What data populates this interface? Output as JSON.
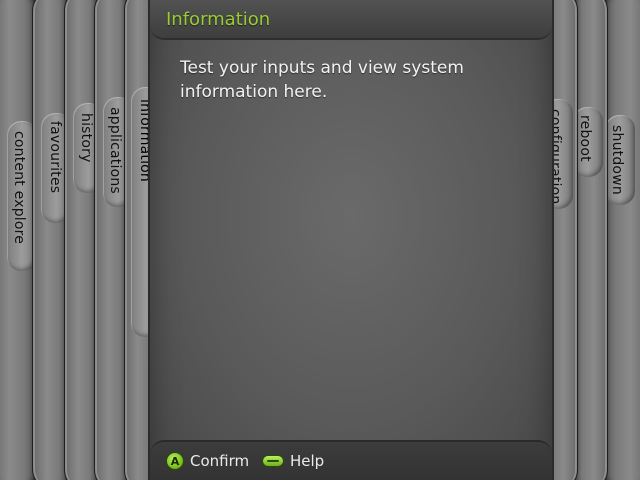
{
  "left_blades": [
    {
      "label": "content explore"
    },
    {
      "label": "favourites"
    },
    {
      "label": "history"
    },
    {
      "label": "applications"
    },
    {
      "label": "information"
    }
  ],
  "right_blades": [
    {
      "label": "configuration"
    },
    {
      "label": "reboot"
    },
    {
      "label": "shutdown"
    }
  ],
  "header": {
    "title": "Information"
  },
  "main": {
    "description": "Test your inputs and view system information here."
  },
  "footer": {
    "confirm": {
      "button_glyph": "A",
      "label": "Confirm",
      "icon": "a-button-icon"
    },
    "help": {
      "label": "Help",
      "icon": "guide-button-icon"
    }
  },
  "colors": {
    "accent": "#9acd32",
    "a_button": "#7cc21e"
  }
}
